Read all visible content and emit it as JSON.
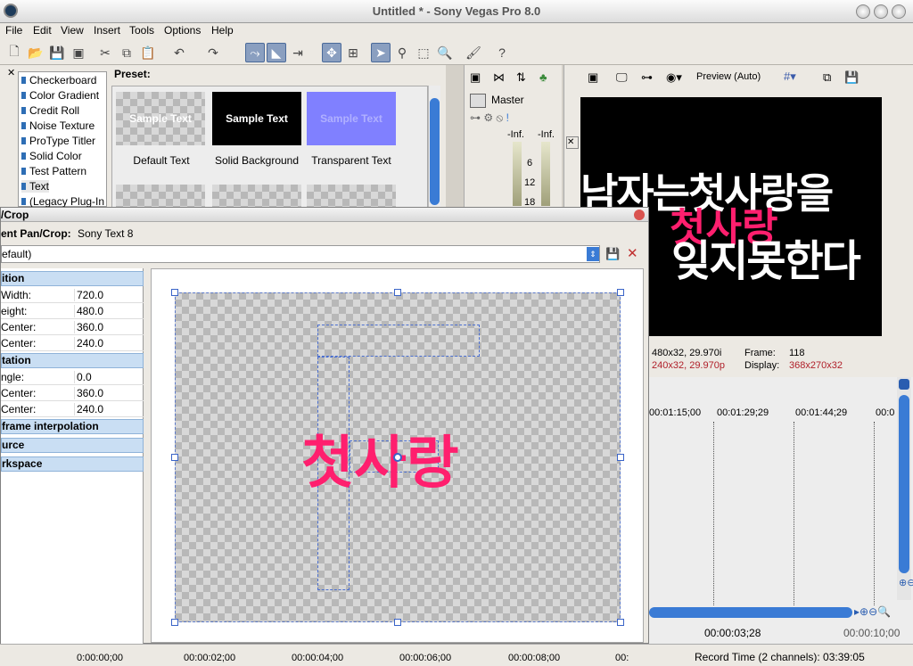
{
  "app": {
    "title": "Untitled * - Sony Vegas Pro 8.0"
  },
  "menu": [
    "File",
    "Edit",
    "View",
    "Insert",
    "Tools",
    "Options",
    "Help"
  ],
  "media_generators": {
    "list": [
      "Checkerboard",
      "Color Gradient",
      "Credit Roll",
      "Noise Texture",
      "ProType Titler",
      "Solid Color",
      "Test Pattern",
      "Text",
      "(Legacy Plug-In"
    ],
    "selected": "Text",
    "preset_label": "Preset:",
    "presets": [
      {
        "thumb": "Sample Text",
        "label": "Default Text"
      },
      {
        "thumb": "Sample Text",
        "label": "Solid Background"
      },
      {
        "thumb": "Sample Text",
        "label": "Transparent Text"
      }
    ]
  },
  "mixer": {
    "title": "Master",
    "left_peak": "-Inf.",
    "right_peak": "-Inf.",
    "ticks": [
      "6",
      "12",
      "18"
    ]
  },
  "preview": {
    "mode": "Preview (Auto)",
    "line1": "남자는첫사랑을",
    "highlight": "첫사랑",
    "line2": "잊지못한다",
    "info1_left": "480x32, 29.970i",
    "info1_key": "Frame:",
    "info1_val": "118",
    "info2_left": "240x32, 29.970p",
    "info2_key": "Display:",
    "info2_val": "368x270x32"
  },
  "timeline": {
    "ruler": [
      "00:01:15;00",
      "00:01:29;29",
      "00:01:44;29",
      "00:0"
    ],
    "cursor_time": "00:00:03;28",
    "end_time": "00:00:10;00"
  },
  "panwin": {
    "title": "/Crop",
    "event_label": "ent Pan/Crop:",
    "event_name": "Sony Text 8",
    "preset_value": "efault)",
    "groups": {
      "position": "ition",
      "rotation": "tation",
      "keyframe": "frame interpolation",
      "source": "urce",
      "workspace": "rkspace"
    },
    "position_rows": [
      {
        "k": "Width:",
        "v": "720.0"
      },
      {
        "k": "eight:",
        "v": "480.0"
      },
      {
        "k": " Center:",
        "v": "360.0"
      },
      {
        "k": " Center:",
        "v": "240.0"
      }
    ],
    "rotation_rows": [
      {
        "k": "ngle:",
        "v": "0.0"
      },
      {
        "k": " Center:",
        "v": "360.0"
      },
      {
        "k": " Center:",
        "v": "240.0"
      }
    ],
    "canvas_text": "첫사랑"
  },
  "bottom": {
    "times": [
      "0:00:00;00",
      "00:00:02;00",
      "00:00:04;00",
      "00:00:06;00",
      "00:00:08;00",
      "00:"
    ],
    "record": "Record Time (2 channels): 03:39:05"
  },
  "colors": {
    "accent_pink": "#ff1f6e",
    "group_blue": "#c9def3"
  }
}
